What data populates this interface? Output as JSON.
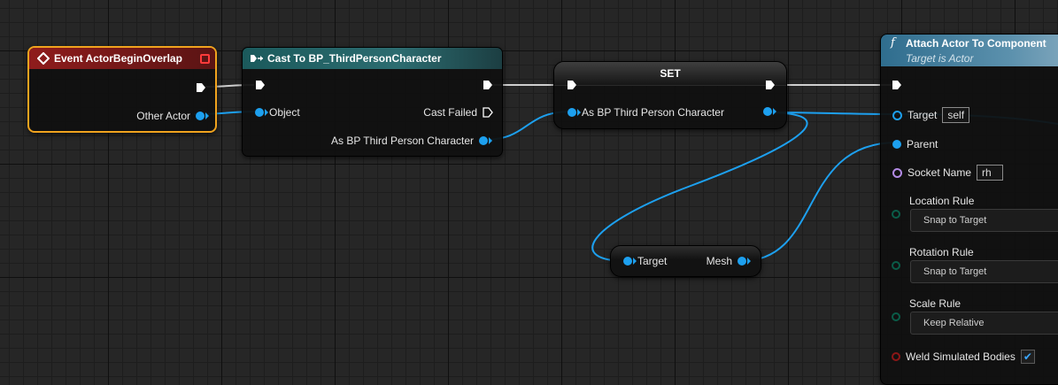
{
  "nodes": {
    "event": {
      "title": "Event ActorBeginOverlap",
      "other_actor": "Other Actor"
    },
    "cast": {
      "title": "Cast To BP_ThirdPersonCharacter",
      "object": "Object",
      "cast_failed": "Cast Failed",
      "as_bp": "As BP Third Person Character"
    },
    "set": {
      "title": "SET",
      "as_bp": "As BP Third Person Character"
    },
    "getter": {
      "target": "Target",
      "mesh": "Mesh"
    },
    "attach": {
      "title": "Attach Actor To Component",
      "subtitle": "Target is Actor",
      "target_label": "Target",
      "target_value": "self",
      "parent_label": "Parent",
      "socket_label": "Socket Name",
      "socket_value": "rh",
      "location_rule_label": "Location Rule",
      "location_rule_value": "Snap to Target",
      "rotation_rule_label": "Rotation Rule",
      "rotation_rule_value": "Snap to Target",
      "scale_rule_label": "Scale Rule",
      "scale_rule_value": "Keep Relative",
      "weld_label": "Weld Simulated Bodies",
      "weld_checked": true
    }
  },
  "colors": {
    "object_pin": "#1da0ef",
    "name_pin": "#b48be6",
    "enum_pin": "#0a5c48",
    "bool_pin": "#8c1616",
    "event_header": "#8f1c1c",
    "cast_header": "#1b5a5c",
    "function_header": "#2f6d8e",
    "selection_outline": "#f0a31e"
  }
}
